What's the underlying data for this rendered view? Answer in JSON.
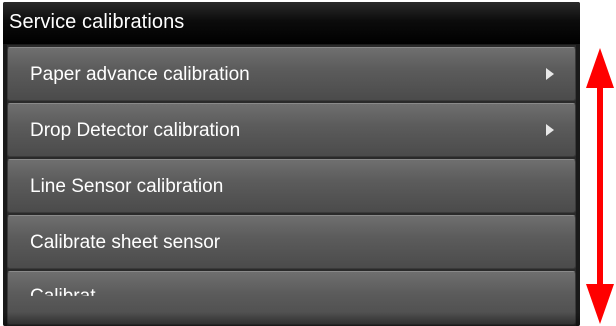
{
  "screen": {
    "title": "Service calibrations",
    "menu_items": [
      {
        "label": "Paper advance calibration",
        "has_submenu": true
      },
      {
        "label": "Drop Detector calibration",
        "has_submenu": true
      },
      {
        "label": "Line Sensor calibration",
        "has_submenu": false
      },
      {
        "label": "Calibrate sheet sensor",
        "has_submenu": false
      },
      {
        "label": "Calibrat...",
        "has_submenu": false
      }
    ]
  },
  "annotation": {
    "icon": "double-headed-vertical-arrow-icon",
    "color": "#ff0000"
  },
  "colors": {
    "item_bg": "#5c5c5c",
    "titlebar_bg": "#000000",
    "text": "#ffffff"
  }
}
